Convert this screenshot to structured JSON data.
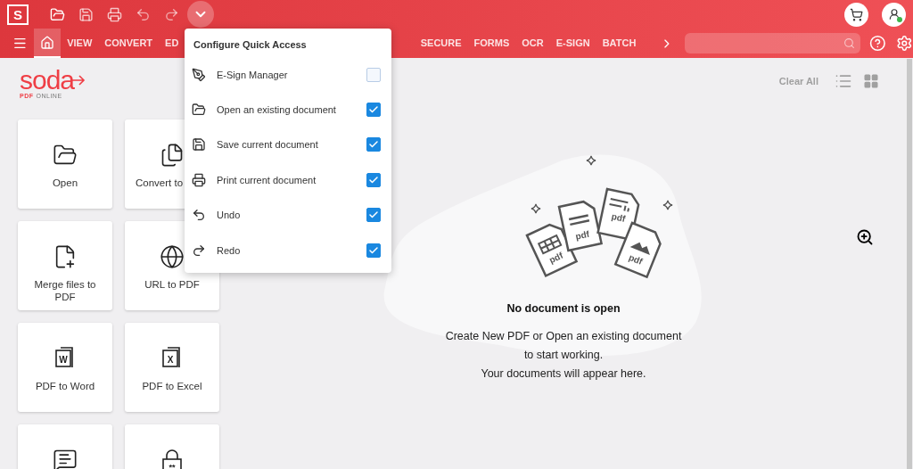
{
  "app_logo": "S",
  "quick_access_menu": {
    "open": true,
    "title": "Configure Quick Access",
    "items": [
      {
        "label": "E-Sign Manager",
        "checked": false
      },
      {
        "label": "Open an existing document",
        "checked": true
      },
      {
        "label": "Save current document",
        "checked": true
      },
      {
        "label": "Print current document",
        "checked": true
      },
      {
        "label": "Undo",
        "checked": true
      },
      {
        "label": "Redo",
        "checked": true
      }
    ]
  },
  "menu": {
    "home_tab": {
      "selected": true
    },
    "tabs": [
      {
        "label": "VIEW",
        "selected": false
      },
      {
        "label": "CONVERT",
        "selected": false
      },
      {
        "label": "ED",
        "selected": false
      },
      {
        "label": "SECURE",
        "selected": false
      },
      {
        "label": "FORMS",
        "selected": false
      },
      {
        "label": "OCR",
        "selected": false
      },
      {
        "label": "E-SIGN",
        "selected": false
      },
      {
        "label": "BATCH",
        "selected": false
      }
    ]
  },
  "brand": {
    "name": "soda",
    "sub_strong": "PDF",
    "sub": "ONLINE"
  },
  "tiles": [
    {
      "kind": "open",
      "label": "Open"
    },
    {
      "kind": "convert",
      "label": "Convert to"
    },
    {
      "kind": "merge",
      "label": "Merge files to PDF"
    },
    {
      "kind": "url",
      "label": "URL to PDF"
    },
    {
      "kind": "document",
      "label": "PDF to Word",
      "icon_text": "W"
    },
    {
      "kind": "document",
      "label": "PDF to Excel",
      "icon_text": "X"
    },
    {
      "kind": "comment"
    },
    {
      "kind": "lock",
      "icon_text": "**"
    }
  ],
  "recent": {
    "clear_label": "Clear All"
  },
  "empty_state": {
    "file_labels": [
      "pdf",
      "pdf",
      "pdf",
      "pdf"
    ],
    "title": "No document is open",
    "lines": [
      "Create New PDF or Open an existing document",
      "to start working.",
      "Your documents will appear here."
    ]
  }
}
